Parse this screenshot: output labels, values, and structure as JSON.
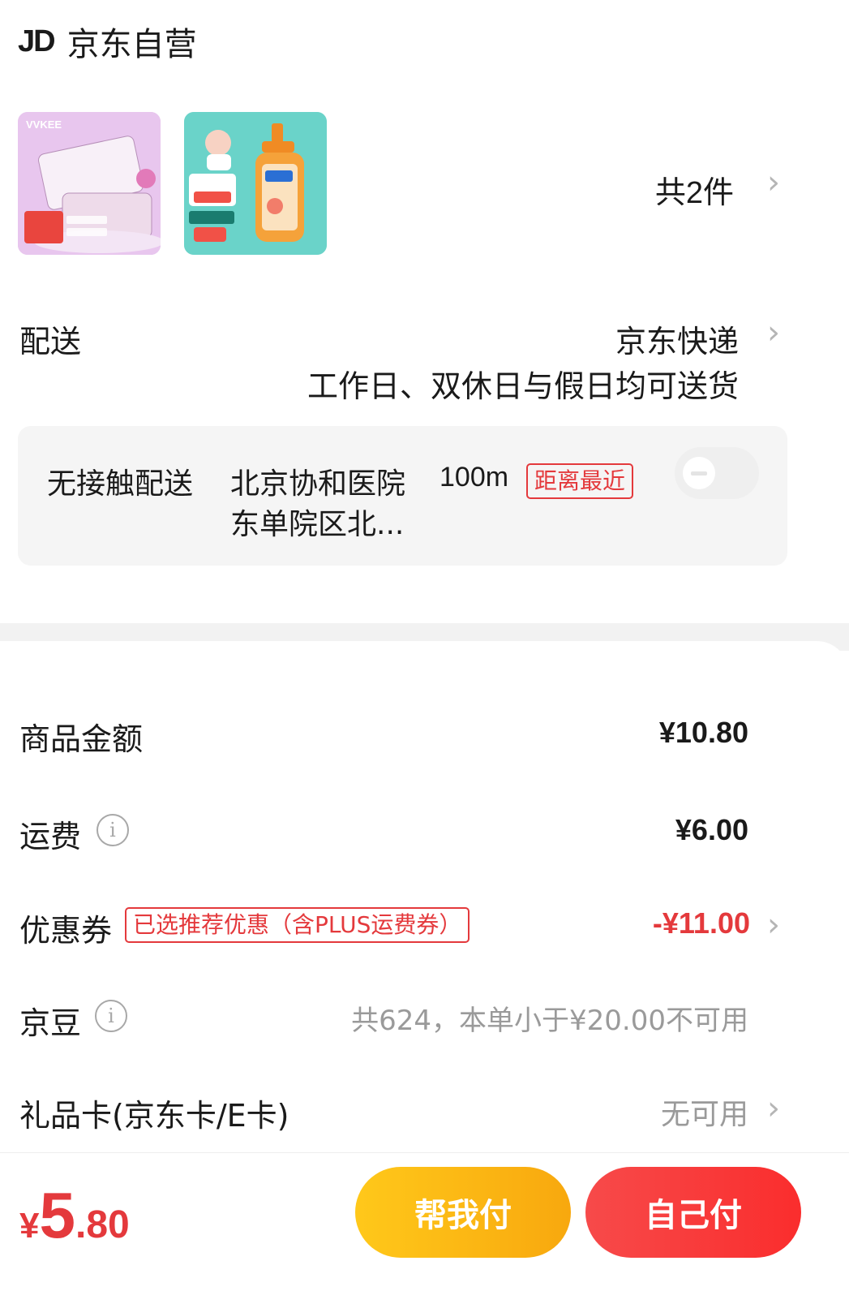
{
  "shop": {
    "logo": "JD",
    "name": "京东自营"
  },
  "goods": {
    "count_label": "共2件"
  },
  "delivery": {
    "label": "配送",
    "carrier": "京东快递",
    "schedule": "工作日、双休日与假日均可送货"
  },
  "contactless": {
    "title": "无接触配送",
    "place_line1": "北京协和医院",
    "place_line2": "东单院区北...",
    "distance": "100m",
    "nearest_tag": "距离最近"
  },
  "summary": {
    "goods_amount_label": "商品金额",
    "goods_amount": "¥10.80",
    "freight_label": "运费",
    "freight": "¥6.00",
    "coupon_label": "优惠券",
    "coupon_tag": "已选推荐优惠（含PLUS运费券）",
    "coupon_value": "-¥11.00",
    "beans_label": "京豆",
    "beans_value": "共624，本单小于¥20.00不可用",
    "giftcard_label": "礼品卡(京东卡/E卡)",
    "giftcard_value": "无可用"
  },
  "footer": {
    "currency": "¥",
    "price_int": "5",
    "price_dec": ".80",
    "help_pay": "帮我付",
    "self_pay": "自己付"
  },
  "icons": {
    "chevron": "chevron-right-icon",
    "info": "info-icon",
    "toggle": "toggle-off-icon"
  },
  "colors": {
    "accent_red": "#e4393c",
    "help_pay_start": "#ffc81a",
    "help_pay_end": "#f8a80e",
    "self_pay_start": "#f74a4a",
    "self_pay_end": "#fa2d2d",
    "panel_bg": "#f5f5f5",
    "muted": "#9a9a9a"
  }
}
